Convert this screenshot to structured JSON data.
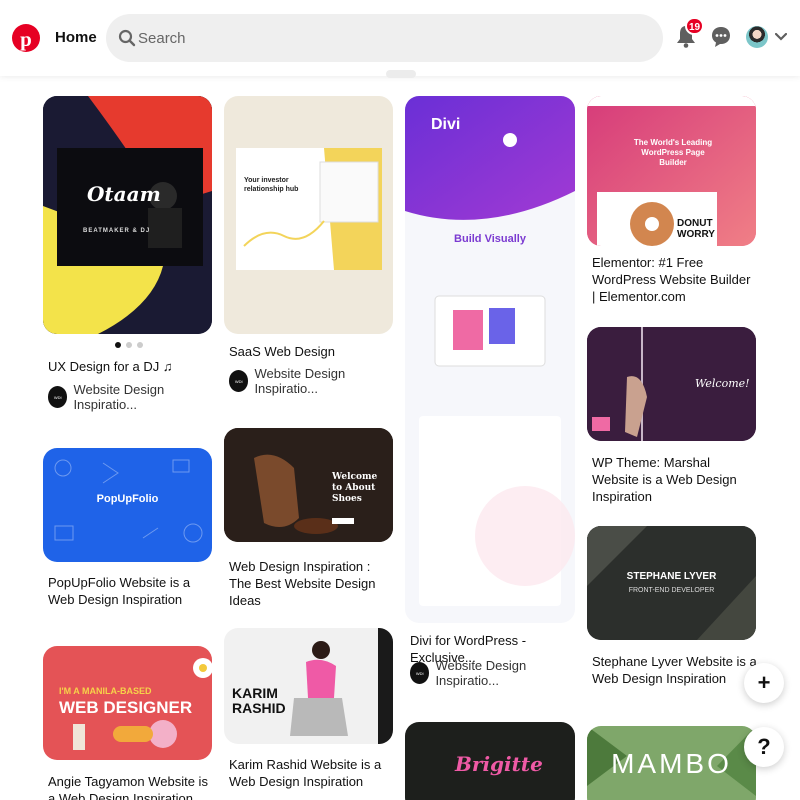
{
  "header": {
    "home_label": "Home",
    "search_placeholder": "Search",
    "notification_count": "19",
    "brand_color": "#e60023"
  },
  "icons": [
    "pinterest-logo-icon",
    "search-icon",
    "bell-icon",
    "chat-icon",
    "avatar",
    "chevron-down-icon",
    "plus-icon",
    "help-icon"
  ],
  "pins": [
    {
      "title": "UX Design for a DJ ♫",
      "author": "Website Design Inspiratio...",
      "image_text": "Otaam",
      "image_sub": "BEATMAKER & DJ",
      "carousel_active": 1,
      "carousel_total": 3
    },
    {
      "title": "SaaS Web Design",
      "author": "Website Design Inspiratio...",
      "image_text": "Your investor relationship hub"
    },
    {
      "title": "Divi for WordPress - Exclusive...",
      "author": "Website Design Inspiratio...",
      "image_text": "Divi",
      "image_sub": "Build Visually"
    },
    {
      "title": "Elementor: #1 Free WordPress Website Builder | Elementor.com",
      "image_text": "The World's Leading WordPress Page Builder",
      "image_sub": "DONUT WORRY"
    },
    {
      "title": "PopUpFolio Website is a Web Design Inspiration",
      "image_text": "PopUpFolio"
    },
    {
      "title": "Web Design Inspiration : The Best Website Design Ideas",
      "image_text": "Welcome to About Shoes"
    },
    {
      "title": "WP Theme: Marshal Website is a Web Design Inspiration",
      "image_text": "Welcome!"
    },
    {
      "title": "Stephane Lyver Website is a Web Design Inspiration",
      "image_text": "STEPHANE LYVER",
      "image_sub": "FRONT-END DEVELOPER"
    },
    {
      "title": "Angie Tagyamon Website is a Web Design Inspiration",
      "image_text": "I'M A MANILA-BASED",
      "image_sub": "WEB DESIGNER"
    },
    {
      "title": "Karim Rashid Website is a Web Design Inspiration",
      "image_text": "KARIM RASHID"
    },
    {
      "title": "",
      "image_text": "Brigitte"
    },
    {
      "title": "",
      "image_text": "MAMBO"
    }
  ],
  "fab": {
    "plus_label": "+",
    "help_label": "?"
  }
}
